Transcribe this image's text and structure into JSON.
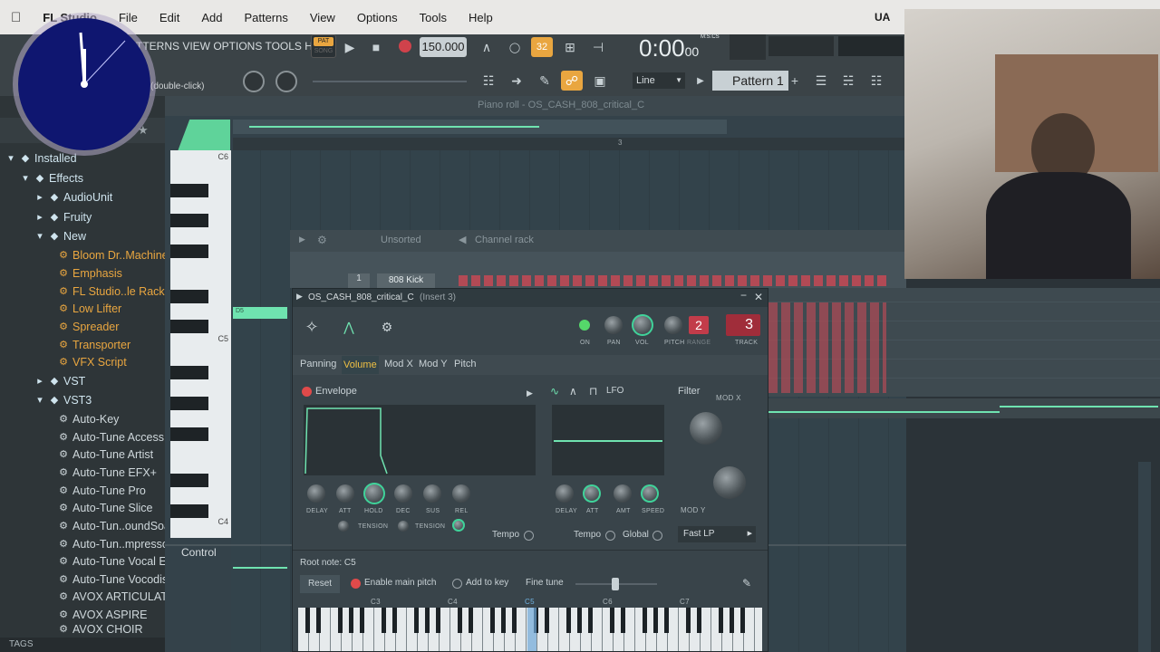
{
  "menubar": {
    "app_name": "FL Studio",
    "items": [
      "File",
      "Edit",
      "Add",
      "Patterns",
      "View",
      "Options",
      "Tools",
      "Help"
    ],
    "right_label": "UA"
  },
  "toolbar": {
    "inner_menu": "TTERNS  VIEW  OPTIONS  TOOLS  HELP",
    "pat_label": "PAT",
    "song_label": "SONG",
    "tempo": "150.000",
    "time_main": "0:00",
    "time_sub": "00",
    "time_unit": "M:S:CS",
    "hint": "(double-click)",
    "snap": "Line",
    "pattern": "Pattern 1",
    "metronome_label": "32"
  },
  "sidebar": {
    "items": [
      {
        "label": "Installed",
        "type": "folder"
      },
      {
        "label": "Effects",
        "type": "folder"
      },
      {
        "label": "AudioUnit",
        "type": "folder"
      },
      {
        "label": "Fruity",
        "type": "folder"
      },
      {
        "label": "New",
        "type": "folder"
      },
      {
        "label": "Bloom Dr..Machine",
        "type": "plugin"
      },
      {
        "label": "Emphasis",
        "type": "plugin"
      },
      {
        "label": "FL Studio..le Rack FX",
        "type": "plugin"
      },
      {
        "label": "Low Lifter",
        "type": "plugin"
      },
      {
        "label": "Spreader",
        "type": "plugin"
      },
      {
        "label": "Transporter",
        "type": "plugin"
      },
      {
        "label": "VFX Script",
        "type": "plugin"
      },
      {
        "label": "VST",
        "type": "folder"
      },
      {
        "label": "VST3",
        "type": "folder"
      },
      {
        "label": "Auto-Key",
        "type": "plugin2"
      },
      {
        "label": "Auto-Tune Access",
        "type": "plugin2"
      },
      {
        "label": "Auto-Tune Artist",
        "type": "plugin2"
      },
      {
        "label": "Auto-Tune EFX+",
        "type": "plugin2"
      },
      {
        "label": "Auto-Tune Pro",
        "type": "plugin2"
      },
      {
        "label": "Auto-Tune Slice",
        "type": "plugin2"
      },
      {
        "label": "Auto-Tun..oundSoap",
        "type": "plugin2"
      },
      {
        "label": "Auto-Tun..mpressor",
        "type": "plugin2"
      },
      {
        "label": "Auto-Tune Vocal EQ",
        "type": "plugin2"
      },
      {
        "label": "Auto-Tune Vocodist",
        "type": "plugin2"
      },
      {
        "label": "AVOX ARTICULATOR",
        "type": "plugin2"
      },
      {
        "label": "AVOX ASPIRE",
        "type": "plugin2"
      },
      {
        "label": "AVOX CHOIR",
        "type": "plugin2"
      }
    ],
    "tags_label": "TAGS"
  },
  "pianoroll": {
    "title": "Piano roll - OS_CASH_808_critical_C",
    "bar_marker": "3",
    "note_labels": [
      "C6",
      "C5",
      "C4"
    ],
    "note_block": "D5",
    "control_label": "Control"
  },
  "channelrack": {
    "sort_label": "Unsorted",
    "title": "Channel rack",
    "channel_number": "1",
    "channel_name": "808 Kick"
  },
  "plugin": {
    "title": "OS_CASH_808_critical_C",
    "insert": "(Insert 3)",
    "tabs": [
      "Panning",
      "Volume",
      "Mod X",
      "Mod Y",
      "Pitch"
    ],
    "active_tab": "Volume",
    "top_knobs": [
      "ON",
      "PAN",
      "VOL",
      "PITCH",
      "RANGE",
      "TRACK"
    ],
    "range_value": "2",
    "track_value": "3",
    "envelope_label": "Envelope",
    "env_knobs": [
      "DELAY",
      "ATT",
      "HOLD",
      "DEC",
      "SUS",
      "REL"
    ],
    "tension_labels": [
      "TENSION",
      "TENSION"
    ],
    "tempo_label": "Tempo",
    "lfo_label": "LFO",
    "lfo_knobs": [
      "DELAY",
      "ATT",
      "AMT",
      "SPEED"
    ],
    "lfo_tempo": "Tempo",
    "global_label": "Global",
    "filter_label": "Filter",
    "modx_label": "MOD X",
    "mody_label": "MOD Y",
    "filter_type": "Fast LP",
    "root_note": "Root note: C5",
    "reset": "Reset",
    "enable_pitch": "Enable main pitch",
    "add_to_key": "Add to key",
    "fine_tune": "Fine tune",
    "keyboard_labels": [
      "C3",
      "C4",
      "C5",
      "C6",
      "C7"
    ]
  },
  "colors": {
    "accent_green": "#3fd39a",
    "accent_orange": "#e9a640",
    "red": "#d0424b",
    "panel": "#39444a"
  }
}
